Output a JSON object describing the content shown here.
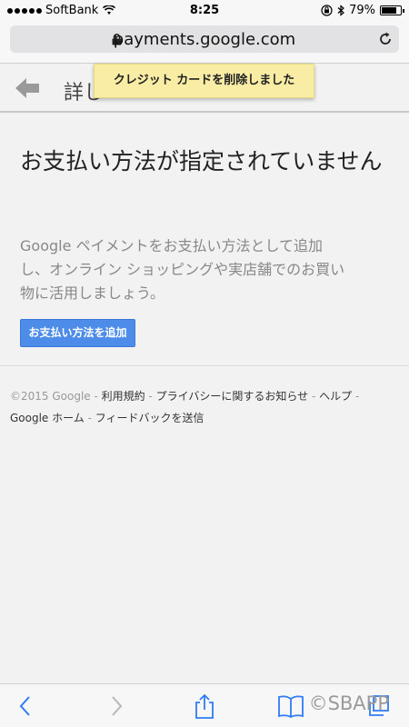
{
  "status_bar": {
    "carrier": "SoftBank",
    "time": "8:25",
    "battery_percent_label": "79%",
    "battery_level": 0.79
  },
  "browser": {
    "url": "payments.google.com"
  },
  "header": {
    "title": "詳し"
  },
  "toast": {
    "message": "クレジット カードを削除しました"
  },
  "main": {
    "title": "お支払い方法が指定されていません",
    "description": "Google ペイメントをお支払い方法として追加し、オンライン ショッピングや実店舗でのお買い物に活用しましょう。",
    "add_button_label": "お支払い方法を追加"
  },
  "footer": {
    "copyright": "©2015 Google",
    "terms": "利用規約",
    "privacy": "プライバシーに関するお知らせ",
    "help": "ヘルプ",
    "google_home": "Google ホーム",
    "feedback": "フィードバックを送信",
    "separator": " - "
  },
  "watermark": "©SBAPP",
  "colors": {
    "accent": "#4d8ce8",
    "toast_bg": "#f9eda6"
  }
}
